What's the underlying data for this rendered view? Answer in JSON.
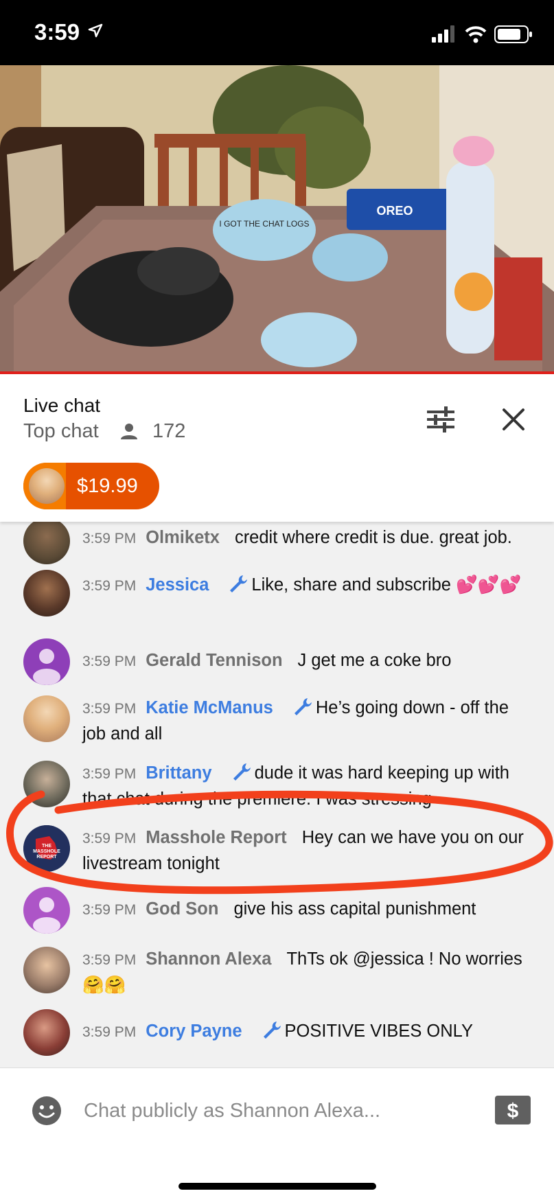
{
  "status_bar": {
    "time": "3:59",
    "icons": [
      "location-arrow-icon",
      "signal-icon",
      "wifi-icon",
      "battery-icon"
    ]
  },
  "video": {
    "mask_print": "I GOT THE CHAT LOGS",
    "brand_print": "OREO"
  },
  "chat_header": {
    "title": "Live chat",
    "mode": "Top chat",
    "viewer_count": "172"
  },
  "superchat": {
    "amount": "$19.99"
  },
  "messages": [
    {
      "time": "3:59 PM",
      "author": "Olmiketx",
      "moderator": false,
      "text": "credit where credit is due. great job."
    },
    {
      "time": "3:59 PM",
      "author": "Jessica",
      "moderator": true,
      "text": "Like, share and subscribe 💕💕💕"
    },
    {
      "time": "3:59 PM",
      "author": "Gerald Tennison",
      "moderator": false,
      "text": "J get me a coke bro"
    },
    {
      "time": "3:59 PM",
      "author": "Katie McManus",
      "moderator": true,
      "text": "He’s going down - off the job and all"
    },
    {
      "time": "3:59 PM",
      "author": "Brittany",
      "moderator": true,
      "text": "dude it was hard keeping up with that chat during the premiere. I was stressing"
    },
    {
      "time": "3:59 PM",
      "author": "Masshole Report",
      "moderator": false,
      "text": "Hey can we have you on our livestream tonight"
    },
    {
      "time": "3:59 PM",
      "author": "God Son",
      "moderator": false,
      "text": "give his ass capital punishment"
    },
    {
      "time": "3:59 PM",
      "author": "Shannon Alexa",
      "moderator": false,
      "text": "ThTs ok @jessica ! No worries 🤗🤗"
    },
    {
      "time": "3:59 PM",
      "author": "Cory Payne",
      "moderator": true,
      "text": "POSITIVE VIBES ONLY"
    }
  ],
  "avatar_logo_text": "THE MASSHOLE REPORT",
  "input": {
    "placeholder": "Chat publicly as Shannon Alexa..."
  },
  "colors": {
    "accent_red": "#e0201b",
    "moderator_blue": "#3d7de0",
    "superchat_orange": "#e65100",
    "annotation_red": "#f2401c"
  }
}
